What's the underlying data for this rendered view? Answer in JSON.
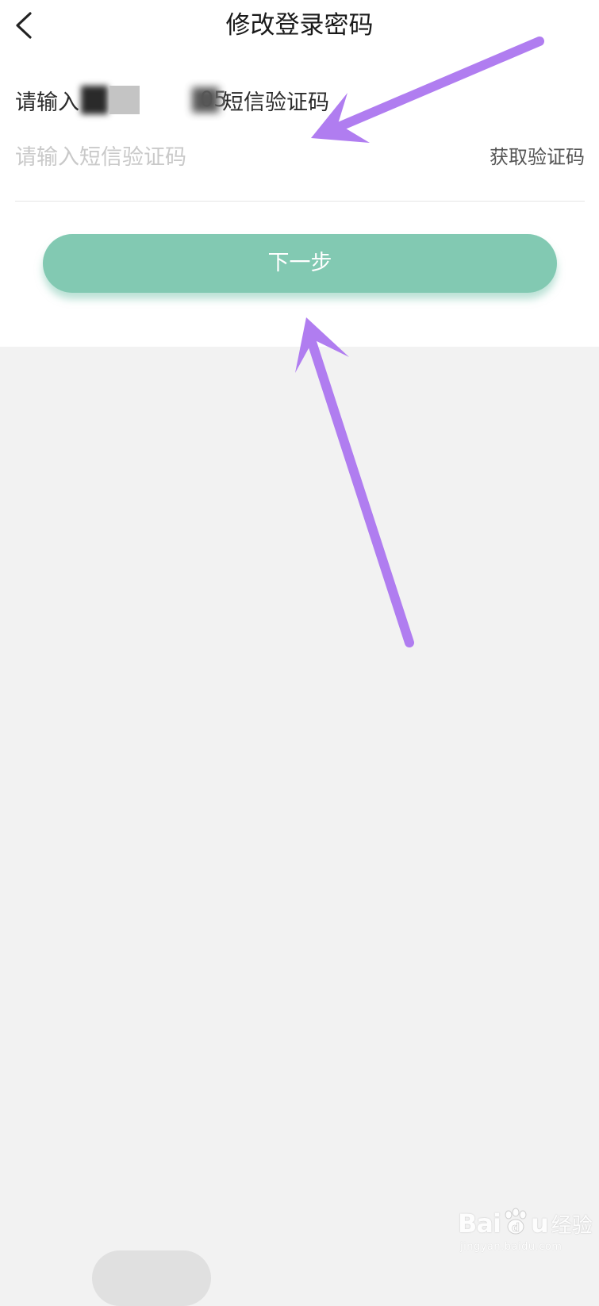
{
  "header": {
    "back_icon": "chevron-left-icon",
    "title": "修改登录密码"
  },
  "sms": {
    "prompt_prefix": "请输入",
    "phone_tail_visible": "05",
    "prompt_suffix": "短信验证码",
    "input_placeholder": "请输入短信验证码",
    "input_value": "",
    "get_code_label": "获取验证码"
  },
  "actions": {
    "next_label": "下一步",
    "next_color": "#82c9b2"
  },
  "annotations": {
    "arrow_color": "#b07df0"
  },
  "watermark": {
    "logo_left": "Bai",
    "logo_right": "u",
    "brand": "经验",
    "url": "jingyan.baidu.com"
  }
}
